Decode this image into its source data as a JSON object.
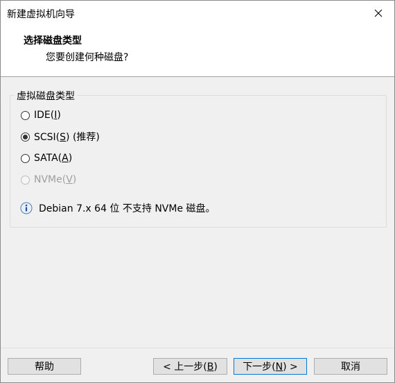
{
  "window": {
    "title": "新建虚拟机向导"
  },
  "header": {
    "title": "选择磁盘类型",
    "subtitle": "您要创建何种磁盘?"
  },
  "group": {
    "legend": "虚拟磁盘类型",
    "options": [
      {
        "prefix": "IDE(",
        "key": "I",
        "suffix": ")",
        "extra": "",
        "checked": false,
        "disabled": false
      },
      {
        "prefix": "SCSI(",
        "key": "S",
        "suffix": ")",
        "extra": " (推荐)",
        "checked": true,
        "disabled": false
      },
      {
        "prefix": "SATA(",
        "key": "A",
        "suffix": ")",
        "extra": "",
        "checked": false,
        "disabled": false
      },
      {
        "prefix": "NVMe(",
        "key": "V",
        "suffix": ")",
        "extra": "",
        "checked": false,
        "disabled": true
      }
    ],
    "note": "Debian 7.x 64 位 不支持 NVMe 磁盘。",
    "note_icon": "info-icon"
  },
  "buttons": {
    "help": "帮助",
    "back": {
      "prefix": "< 上一步(",
      "key": "B",
      "suffix": ")"
    },
    "next": {
      "prefix": "下一步(",
      "key": "N",
      "suffix": ") >"
    },
    "cancel": "取消"
  },
  "colors": {
    "accent": "#0078d7",
    "window_bg": "#f0f0f0",
    "button_bg": "#e1e1e1"
  }
}
